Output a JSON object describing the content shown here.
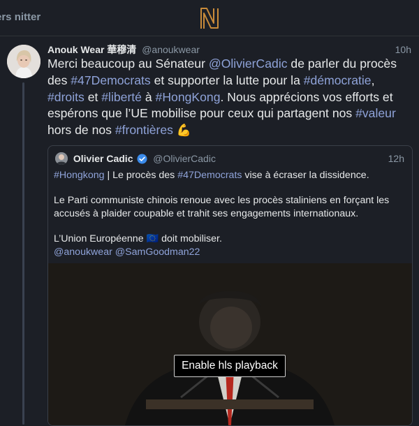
{
  "topbar": {
    "left_text": "ers nitter"
  },
  "tweet": {
    "author_name": "Anouk Wear 華穆清",
    "author_handle": "@anoukwear",
    "time": "10h",
    "t": [
      "Merci beaucoup  au Sénateur ",
      "@OlivierCadic",
      " de parler du procès des ",
      "#47Democrats",
      " et supporter la lutte pour la ",
      "#démocratie",
      ", ",
      "#droits",
      " et ",
      "#liberté",
      " à ",
      "#HongKong",
      ". Nous apprécions vos efforts et espérons que l’UE mobilise pour ceux qui partagent nos ",
      "#valeur",
      " hors de nos ",
      "#frontières",
      " 💪"
    ]
  },
  "quote": {
    "name": "Olivier Cadic",
    "handle": "@OlivierCadic",
    "time": "12h",
    "l1": [
      "#Hongkong",
      " | Le procès des ",
      "#47Democrats",
      " vise à écraser la dissidence."
    ],
    "l2": "Le Parti communiste chinois renoue avec les procès staliniens en forçant les accusés à plaider coupable et trahit ses engagements internationaux.",
    "l3a": "L’Union Européenne ",
    "l3flag": "🇪🇺",
    "l3b": " doit mobiliser.",
    "mentions": [
      "@anoukwear",
      " @SamGoodman22"
    ],
    "video_button": "Enable hls playback"
  },
  "colors": {
    "link": "#8fa3d9",
    "background": "#1c1f26",
    "text": "#e7e9ea",
    "muted": "#8b98a5"
  },
  "icons": [
    "nitter-logo",
    "verified-badge-icon"
  ]
}
